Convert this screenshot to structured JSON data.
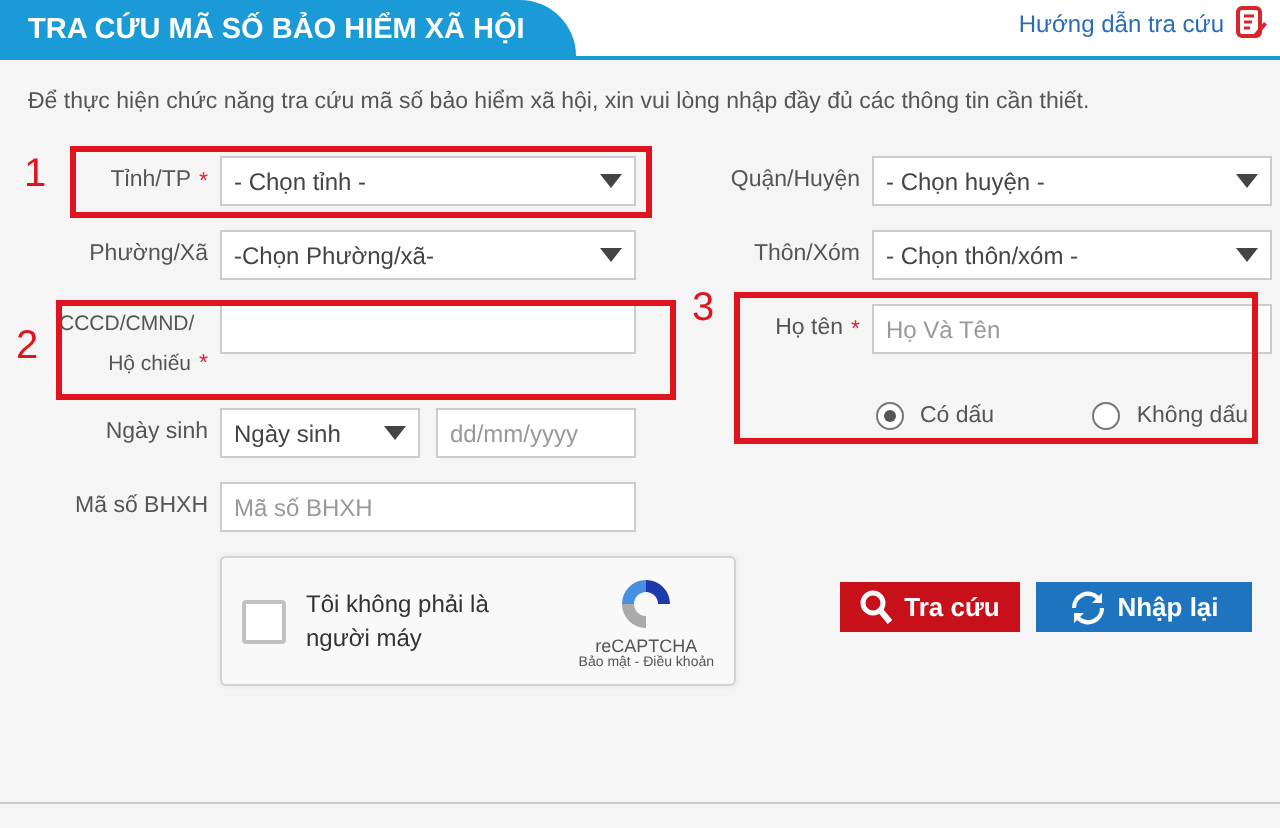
{
  "header": {
    "title": "TRA CỨU MÃ SỐ BẢO HIỂM XÃ HỘI",
    "help_link": "Hướng dẫn tra cứu"
  },
  "intro": "Để thực hiện chức năng tra cứu mã số bảo hiểm xã hội, xin vui lòng nhập đầy đủ các thông tin cần thiết.",
  "left_fields": [
    {
      "kind": "select",
      "label": "Tỉnh/TP",
      "required_mark": "*",
      "value": "- Chọn tỉnh -"
    },
    {
      "kind": "select",
      "label": "Phường/Xã",
      "value": "-Chọn Phường/xã-"
    },
    {
      "kind": "input",
      "label": "CCCD/CMND/ Hộ chiếu",
      "required_mark": "*"
    },
    {
      "kind": "date",
      "label": "Ngày sinh",
      "value": "Ngày sinh",
      "placeholder": "dd/mm/yyyy"
    },
    {
      "kind": "input",
      "label": "Mã số BHXH",
      "placeholder": "Mã số BHXH"
    }
  ],
  "right_fields": [
    {
      "kind": "select",
      "label": "Quận/Huyện",
      "value": "- Chọn huyện -"
    },
    {
      "kind": "select",
      "label": "Thôn/Xóm",
      "value": "- Chọn thôn/xóm -"
    },
    {
      "kind": "input",
      "label": "Họ tên",
      "required_mark": "*",
      "placeholder": "Họ Và Tên"
    }
  ],
  "name_options": [
    {
      "label": "Có dấu",
      "selected": true
    },
    {
      "label": "Không dấu",
      "selected": false
    }
  ],
  "captcha": {
    "label": "Tôi không phải là người máy",
    "checked": false,
    "brand": "reCAPTCHA",
    "links": "Bảo mật - Điều khoản"
  },
  "buttons": [
    {
      "kind": "search",
      "label": "Tra cứu"
    },
    {
      "kind": "reset",
      "label": "Nhập lại"
    }
  ],
  "annotations": [
    {
      "label": "1"
    },
    {
      "label": "2"
    },
    {
      "label": "3"
    }
  ]
}
